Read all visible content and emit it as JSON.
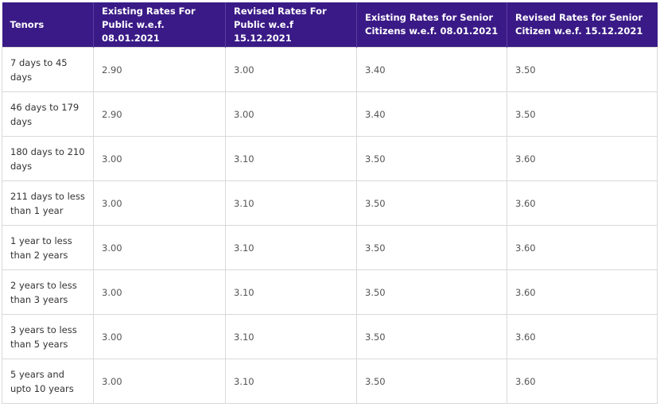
{
  "table": {
    "headers": [
      "Tenors",
      "Existing Rates For Public w.e.f. 08.01.2021",
      "Revised Rates For Public w.e.f 15.12.2021",
      "Existing Rates for Senior Citizens w.e.f. 08.01.2021",
      "Revised Rates for Senior Citizen w.e.f. 15.12.2021"
    ],
    "rows": [
      [
        "7 days to 45 days",
        "2.90",
        "3.00",
        "3.40",
        "3.50"
      ],
      [
        "46 days to 179 days",
        "2.90",
        "3.00",
        "3.40",
        "3.50"
      ],
      [
        "180 days to 210 days",
        "3.00",
        "3.10",
        "3.50",
        "3.60"
      ],
      [
        "211 days to less than 1 year",
        "3.00",
        "3.10",
        "3.50",
        "3.60"
      ],
      [
        "1 year to less than 2 years",
        "3.00",
        "3.10",
        "3.50",
        "3.60"
      ],
      [
        "2 years to less than 3 years",
        "3.00",
        "3.10",
        "3.50",
        "3.60"
      ],
      [
        "3 years to less than 5 years",
        "3.00",
        "3.10",
        "3.50",
        "3.60"
      ],
      [
        "5 years and upto 10 years",
        "3.00",
        "3.10",
        "3.50",
        "3.60"
      ]
    ]
  },
  "colors": {
    "header_bg": "#3a1a86",
    "header_text": "#ffffff",
    "cell_border": "#d9d9d9"
  }
}
